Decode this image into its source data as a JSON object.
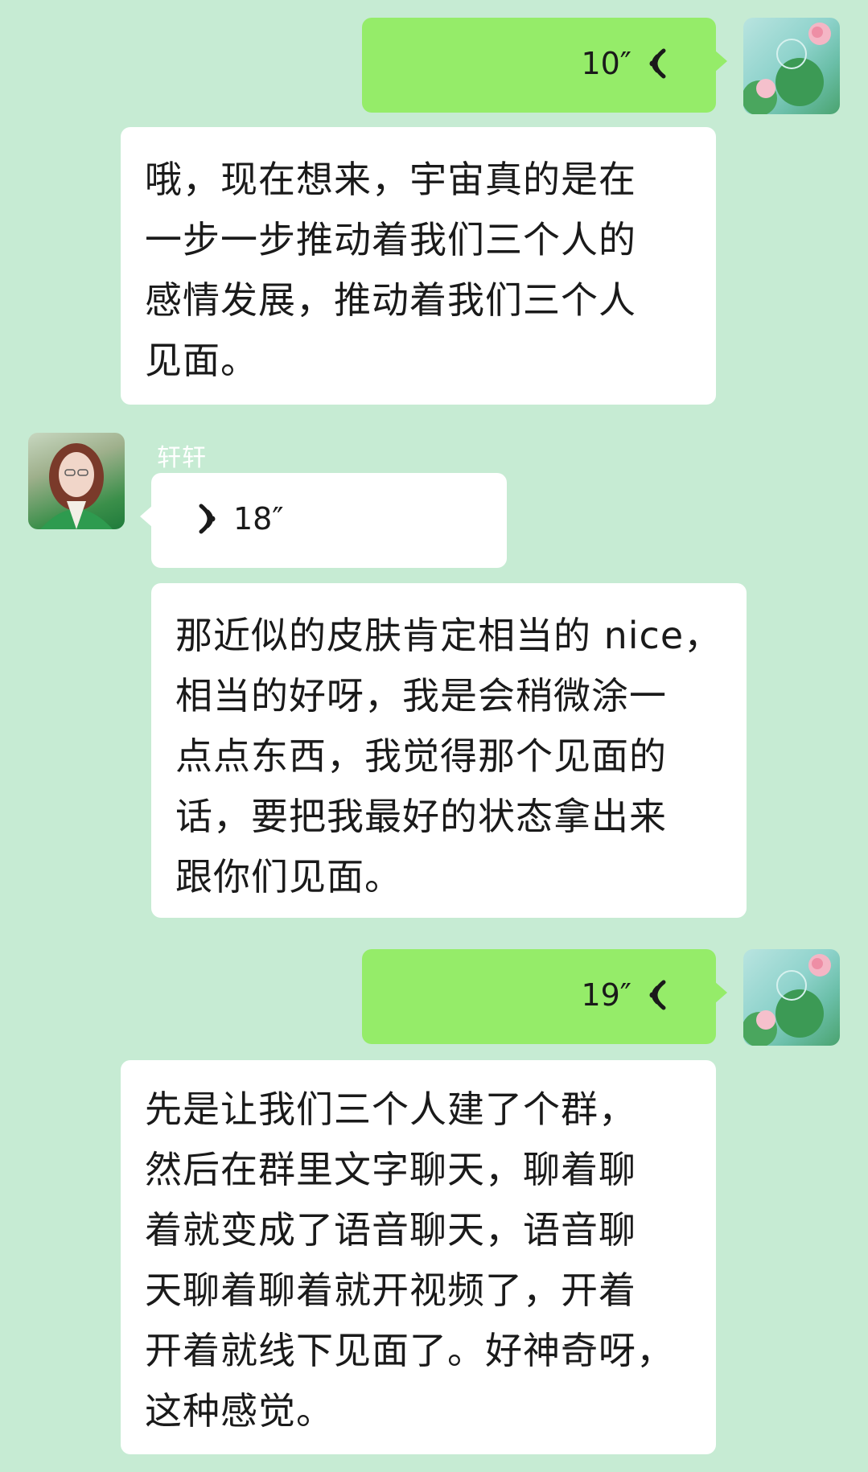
{
  "messages": [
    {
      "side": "right",
      "type": "voice",
      "duration": "10″"
    },
    {
      "side": "right",
      "type": "text",
      "text": "哦，现在想来，宇宙真的是在\n一步一步推动着我们三个人的\n感情发展，推动着我们三个人\n见面。"
    },
    {
      "side": "left",
      "type": "voice",
      "sender": "轩轩",
      "duration": "18″"
    },
    {
      "side": "left",
      "type": "text",
      "text": "那近似的皮肤肯定相当的 nice，\n相当的好呀，我是会稍微涂一\n点点东西，我觉得那个见面的\n话，要把我最好的状态拿出来\n跟你们见面。"
    },
    {
      "side": "right",
      "type": "voice",
      "duration": "19″"
    },
    {
      "side": "right",
      "type": "text",
      "text": "先是让我们三个人建了个群，\n然后在群里文字聊天，聊着聊\n着就变成了语音聊天，语音聊\n天聊着聊着就开视频了，开着\n开着就线下见面了。好神奇呀，\n这种感觉。"
    }
  ],
  "colors": {
    "background": "#c6ebd3",
    "bubble_sent": "#95ec69",
    "bubble_received": "#ffffff"
  },
  "icons": [
    "voice-wave-icon-sent",
    "voice-wave-icon-received",
    "lotus-avatar",
    "user-avatar"
  ]
}
